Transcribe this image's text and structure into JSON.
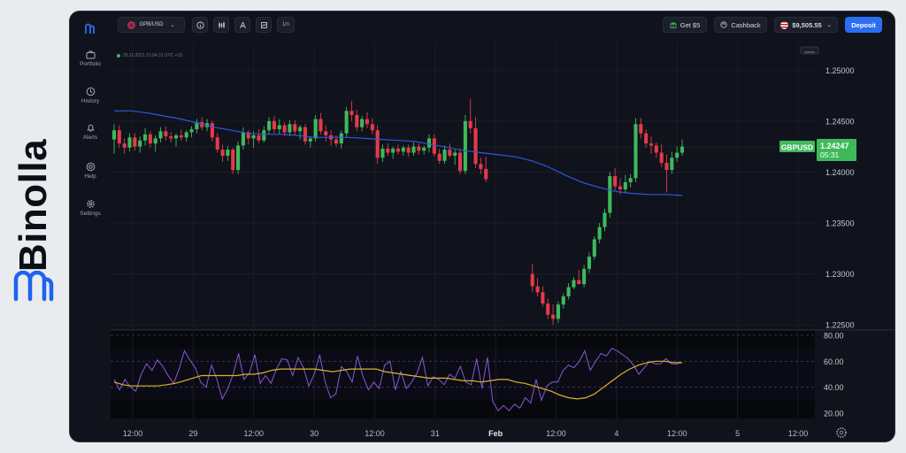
{
  "brand": {
    "name": "Binolla"
  },
  "sidebar": {
    "items": [
      {
        "label": "Portfolio",
        "icon": "briefcase-icon"
      },
      {
        "label": "History",
        "icon": "clock-icon"
      },
      {
        "label": "Alerts",
        "icon": "bell-icon"
      },
      {
        "label": "Help",
        "icon": "help-icon"
      },
      {
        "label": "Settings",
        "icon": "gear-icon"
      }
    ]
  },
  "topbar": {
    "asset": "GPB/USD",
    "timeframe": "1m",
    "get_bonus": "Get $5",
    "cashback": "Cashback",
    "balance": "$9,505.55",
    "deposit": "Deposit"
  },
  "chart_info": {
    "timestamp": "25.11.2021  21:04:31  UTC +10"
  },
  "colors": {
    "bull": "#3fb95b",
    "bear": "#e6394b",
    "ma": "#2e57d8",
    "rsi": "#8a58d6",
    "rsi_ma": "#d9b52a",
    "accent": "#2c6ef1"
  },
  "chart_data": {
    "type": "candlestick",
    "symbol": "GBPUSD",
    "last_price": "1.24247",
    "countdown": "05:31",
    "price_ticks": [
      "1.25000",
      "1.24500",
      "1.24000",
      "1.23500",
      "1.23000",
      "1.22500"
    ],
    "ylim": [
      1.2245,
      1.2528
    ],
    "x_labels": [
      "12:00",
      "29",
      "12:00",
      "30",
      "12:00",
      "31",
      "Feb",
      "12:00",
      "4",
      "12:00",
      "5",
      "12:00"
    ],
    "rsi_ticks": [
      "80.00",
      "60.00",
      "40.00",
      "20.00"
    ],
    "rsi_ylim": [
      16,
      84
    ],
    "candles": [
      [
        1.2432,
        1.2447,
        1.2418,
        1.2441
      ],
      [
        1.2441,
        1.2446,
        1.2424,
        1.2428
      ],
      [
        1.2428,
        1.2433,
        1.2418,
        1.2424
      ],
      [
        1.2424,
        1.2438,
        1.242,
        1.2434
      ],
      [
        1.2434,
        1.2438,
        1.2421,
        1.2425
      ],
      [
        1.2425,
        1.2435,
        1.2419,
        1.2431
      ],
      [
        1.2431,
        1.2443,
        1.2426,
        1.2437
      ],
      [
        1.2437,
        1.244,
        1.2424,
        1.2428
      ],
      [
        1.2428,
        1.2436,
        1.242,
        1.2433
      ],
      [
        1.2433,
        1.2444,
        1.2429,
        1.244
      ],
      [
        1.244,
        1.2445,
        1.2431,
        1.2435
      ],
      [
        1.2435,
        1.2439,
        1.2429,
        1.2433
      ],
      [
        1.2433,
        1.2438,
        1.2425,
        1.2436
      ],
      [
        1.2436,
        1.2442,
        1.2431,
        1.2434
      ],
      [
        1.2434,
        1.2441,
        1.243,
        1.2439
      ],
      [
        1.2439,
        1.2445,
        1.2434,
        1.2442
      ],
      [
        1.2442,
        1.2452,
        1.2438,
        1.2449
      ],
      [
        1.2449,
        1.2454,
        1.2441,
        1.2444
      ],
      [
        1.2444,
        1.2452,
        1.244,
        1.2448
      ],
      [
        1.2448,
        1.245,
        1.243,
        1.2434
      ],
      [
        1.2434,
        1.2438,
        1.2419,
        1.2422
      ],
      [
        1.2422,
        1.2427,
        1.241,
        1.2416
      ],
      [
        1.2416,
        1.2426,
        1.2411,
        1.2422
      ],
      [
        1.2422,
        1.2424,
        1.2398,
        1.2402
      ],
      [
        1.2402,
        1.243,
        1.2398,
        1.2426
      ],
      [
        1.2426,
        1.2444,
        1.2422,
        1.2439
      ],
      [
        1.2439,
        1.2441,
        1.2427,
        1.2433
      ],
      [
        1.2433,
        1.244,
        1.2424,
        1.2436
      ],
      [
        1.2436,
        1.2442,
        1.2428,
        1.2431
      ],
      [
        1.2431,
        1.2445,
        1.2429,
        1.2441
      ],
      [
        1.2441,
        1.2454,
        1.2437,
        1.245
      ],
      [
        1.245,
        1.2455,
        1.2438,
        1.2442
      ],
      [
        1.2442,
        1.2452,
        1.2437,
        1.2446
      ],
      [
        1.2446,
        1.2449,
        1.2435,
        1.2439
      ],
      [
        1.2439,
        1.2451,
        1.2435,
        1.2447
      ],
      [
        1.2447,
        1.2451,
        1.2436,
        1.244
      ],
      [
        1.244,
        1.2446,
        1.2432,
        1.2444
      ],
      [
        1.2444,
        1.2447,
        1.2427,
        1.243
      ],
      [
        1.243,
        1.2435,
        1.2424,
        1.2433
      ],
      [
        1.2433,
        1.2456,
        1.243,
        1.2452
      ],
      [
        1.2452,
        1.2458,
        1.2437,
        1.244
      ],
      [
        1.244,
        1.2446,
        1.243,
        1.2436
      ],
      [
        1.2436,
        1.2441,
        1.2426,
        1.2432
      ],
      [
        1.2432,
        1.2436,
        1.2425,
        1.2428
      ],
      [
        1.2428,
        1.2441,
        1.2423,
        1.2438
      ],
      [
        1.2438,
        1.2464,
        1.2434,
        1.246
      ],
      [
        1.246,
        1.247,
        1.245,
        1.2456
      ],
      [
        1.2456,
        1.2461,
        1.244,
        1.2444
      ],
      [
        1.2444,
        1.2455,
        1.244,
        1.2452
      ],
      [
        1.2452,
        1.2459,
        1.2443,
        1.2447
      ],
      [
        1.2447,
        1.2453,
        1.2437,
        1.2441
      ],
      [
        1.2441,
        1.2446,
        1.2408,
        1.2414
      ],
      [
        1.2414,
        1.2427,
        1.241,
        1.2423
      ],
      [
        1.2423,
        1.2428,
        1.2416,
        1.2419
      ],
      [
        1.2419,
        1.2425,
        1.2413,
        1.2423
      ],
      [
        1.2423,
        1.2427,
        1.2417,
        1.242
      ],
      [
        1.242,
        1.2426,
        1.2416,
        1.2424
      ],
      [
        1.2424,
        1.2427,
        1.2415,
        1.2419
      ],
      [
        1.2419,
        1.2429,
        1.2416,
        1.2425
      ],
      [
        1.2425,
        1.2428,
        1.2417,
        1.2421
      ],
      [
        1.2421,
        1.2426,
        1.2417,
        1.2424
      ],
      [
        1.2424,
        1.2437,
        1.2419,
        1.2433
      ],
      [
        1.2433,
        1.2437,
        1.2415,
        1.2418
      ],
      [
        1.2418,
        1.2423,
        1.2408,
        1.2411
      ],
      [
        1.2411,
        1.2426,
        1.2408,
        1.2422
      ],
      [
        1.2422,
        1.2428,
        1.2414,
        1.2416
      ],
      [
        1.2416,
        1.2422,
        1.2407,
        1.2419
      ],
      [
        1.2419,
        1.2423,
        1.2398,
        1.2401
      ],
      [
        1.2401,
        1.2456,
        1.2398,
        1.245
      ],
      [
        1.245,
        1.2472,
        1.2438,
        1.2443
      ],
      [
        1.2443,
        1.2454,
        1.2404,
        1.2408
      ],
      [
        1.2408,
        1.2414,
        1.2398,
        1.2403
      ],
      [
        1.2403,
        1.2415,
        1.239,
        1.2393
      ],
      null,
      null,
      null,
      null,
      null,
      null,
      null,
      null,
      [
        1.23,
        1.231,
        1.2282,
        1.2288
      ],
      [
        1.2288,
        1.2296,
        1.2278,
        1.2282
      ],
      [
        1.2282,
        1.2288,
        1.2268,
        1.2271
      ],
      [
        1.2271,
        1.2276,
        1.2256,
        1.226
      ],
      [
        1.226,
        1.227,
        1.225,
        1.2256
      ],
      [
        1.2256,
        1.2273,
        1.2252,
        1.227
      ],
      [
        1.227,
        1.2281,
        1.2266,
        1.2278
      ],
      [
        1.2278,
        1.2291,
        1.2275,
        1.2287
      ],
      [
        1.2287,
        1.2297,
        1.2285,
        1.2294
      ],
      [
        1.2294,
        1.2304,
        1.229,
        1.229
      ],
      [
        1.229,
        1.2309,
        1.2287,
        1.2305
      ],
      [
        1.2305,
        1.2321,
        1.2301,
        1.2317
      ],
      [
        1.2317,
        1.2337,
        1.2314,
        1.2334
      ],
      [
        1.2334,
        1.235,
        1.233,
        1.2346
      ],
      [
        1.2346,
        1.2364,
        1.2342,
        1.236
      ],
      [
        1.236,
        1.24,
        1.2355,
        1.2396
      ],
      [
        1.2396,
        1.2404,
        1.2382,
        1.2386
      ],
      [
        1.2386,
        1.2394,
        1.2378,
        1.2383
      ],
      [
        1.2383,
        1.2397,
        1.2379,
        1.239
      ],
      [
        1.239,
        1.2398,
        1.2385,
        1.2394
      ],
      [
        1.2394,
        1.2453,
        1.239,
        1.2447
      ],
      [
        1.2447,
        1.2453,
        1.2433,
        1.2438
      ],
      [
        1.2438,
        1.2442,
        1.2424,
        1.2428
      ],
      [
        1.2428,
        1.2435,
        1.2418,
        1.2426
      ],
      [
        1.2426,
        1.2429,
        1.2414,
        1.2419
      ],
      [
        1.2419,
        1.2427,
        1.2405,
        1.2409
      ],
      [
        1.2409,
        1.2417,
        1.238,
        1.2402
      ],
      [
        1.2402,
        1.242,
        1.2398,
        1.2414
      ],
      [
        1.2414,
        1.2425,
        1.241,
        1.2419
      ],
      [
        1.2419,
        1.2432,
        1.2416,
        1.2425
      ]
    ],
    "ma": [
      1.246,
      1.246,
      1.2458,
      1.2455,
      1.2452,
      1.2448,
      1.2444,
      1.2441,
      1.2438,
      1.2437,
      1.2437,
      1.2436,
      1.2434,
      1.2434,
      1.2434,
      1.2433,
      1.2432,
      1.2431,
      1.243,
      1.2427,
      1.2424,
      1.2421,
      1.2419,
      1.2417,
      1.2415,
      1.2411,
      1.2405,
      1.2397,
      1.239,
      1.2385,
      1.2381,
      1.2379,
      1.2378,
      1.2378,
      1.2377
    ],
    "rsi": [
      46,
      38,
      46,
      40,
      37,
      50,
      58,
      53,
      61,
      56,
      49,
      43,
      54,
      68,
      61,
      55,
      44,
      40,
      57,
      46,
      31,
      39,
      50,
      66,
      46,
      51,
      65,
      43,
      49,
      43,
      54,
      62,
      61,
      49,
      63,
      55,
      41,
      50,
      65,
      44,
      32,
      35,
      56,
      52,
      44,
      64,
      48,
      38,
      44,
      39,
      57,
      60,
      38,
      52,
      39,
      44,
      51,
      63,
      41,
      48,
      46,
      42,
      50,
      47,
      56,
      44,
      42,
      62,
      39,
      63,
      29,
      22,
      26,
      22,
      27,
      24,
      32,
      28,
      46,
      30,
      41,
      44,
      44,
      53,
      57,
      55,
      60,
      68,
      53,
      60,
      66,
      64,
      70,
      68,
      65,
      62,
      57,
      50,
      55,
      60,
      58,
      58,
      62,
      58,
      58,
      59
    ],
    "rsi_ma": [
      44,
      42,
      41,
      41,
      41,
      41,
      42,
      43,
      45,
      47,
      49,
      49,
      49,
      49,
      49,
      50,
      50,
      51,
      53,
      54,
      54,
      54,
      54,
      54,
      53,
      52,
      53,
      54,
      54,
      54,
      54,
      52,
      51,
      50,
      49,
      48,
      47,
      47,
      47,
      46,
      45,
      45,
      44,
      45,
      46,
      46,
      44,
      43,
      41,
      39,
      37,
      34,
      32,
      31,
      32,
      35,
      40,
      45,
      50,
      54,
      57,
      59,
      60,
      60,
      59,
      59
    ]
  }
}
